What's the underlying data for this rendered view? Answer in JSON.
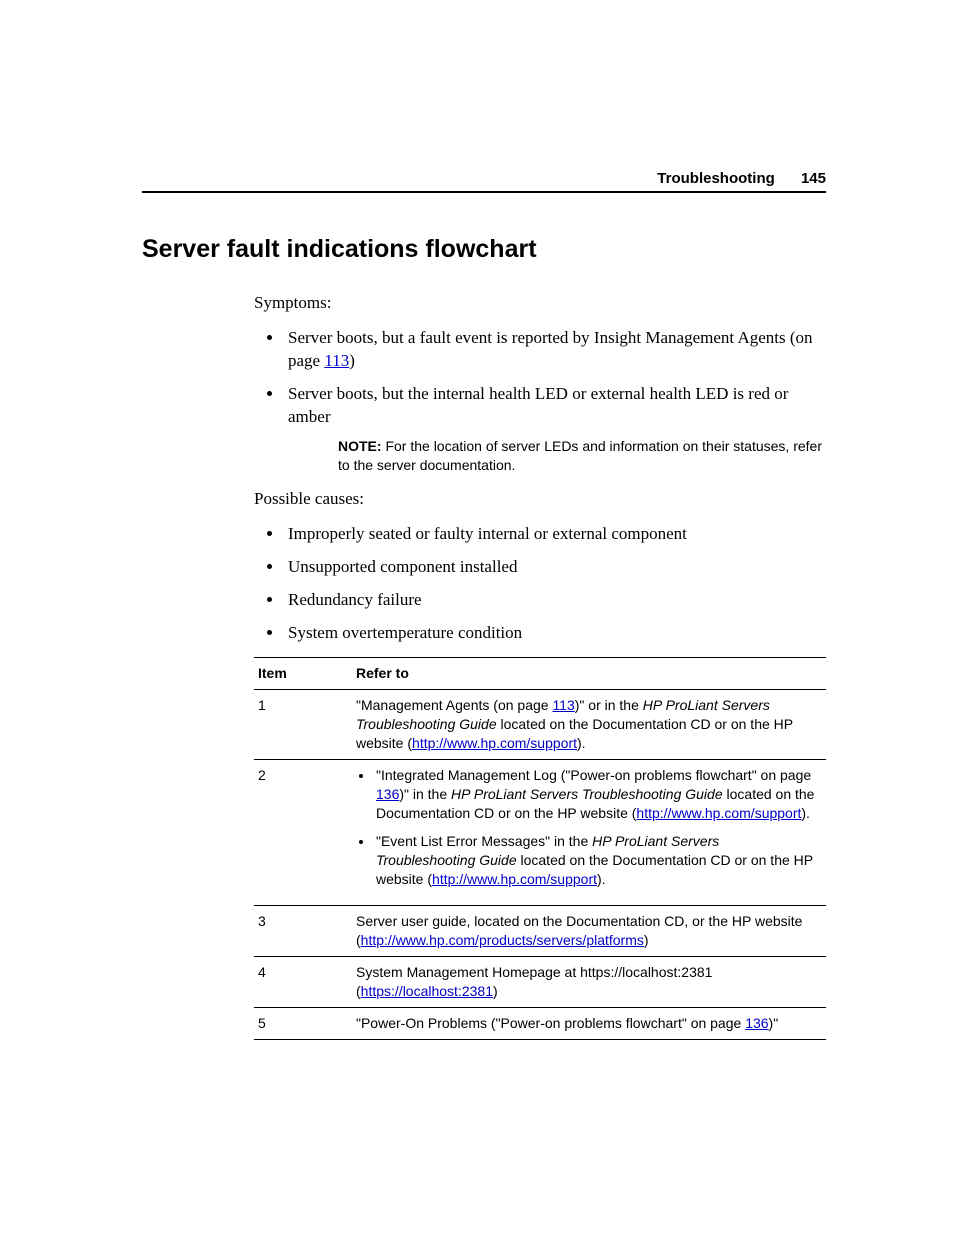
{
  "header": {
    "section": "Troubleshooting",
    "page": "145"
  },
  "title": "Server fault indications flowchart",
  "symptoms_label": "Symptoms:",
  "symptoms": {
    "s1_a": "Server boots, but a fault event is reported by Insight Management Agents (on page ",
    "s1_link": "113",
    "s1_b": ")",
    "s2": "Server boots, but the internal health LED or external health LED is red or amber"
  },
  "note": {
    "label": "NOTE:",
    "text": "  For the location of server LEDs and information on their statuses, refer to the server documentation."
  },
  "causes_label": "Possible causes:",
  "causes": {
    "c1": "Improperly seated or faulty internal or external component",
    "c2": "Unsupported component installed",
    "c3": "Redundancy failure",
    "c4": "System overtemperature condition"
  },
  "table": {
    "h_item": "Item",
    "h_refer": "Refer to",
    "r1": {
      "item": "1",
      "a": "\"Management Agents (on page ",
      "link1": "113",
      "b": ")\" or in the ",
      "italic1": "HP ProLiant Servers Troubleshooting Guide",
      "c": " located on the Documentation CD or on the HP website (",
      "url": "http://www.hp.com/support",
      "d": ")."
    },
    "r2": {
      "item": "2",
      "li1_a": "\"Integrated Management Log (\"Power-on problems flowchart\" on page ",
      "li1_link": "136",
      "li1_b": ")\" in the ",
      "li1_italic": "HP ProLiant Servers Troubleshooting Guide",
      "li1_c": " located on the Documentation CD or on the HP website (",
      "li1_url": "http://www.hp.com/support",
      "li1_d": ").",
      "li2_a": "\"Event List Error Messages\" in the ",
      "li2_italic": "HP ProLiant Servers Troubleshooting Guide",
      "li2_b": " located on the Documentation CD or on the HP website (",
      "li2_url": "http://www.hp.com/support",
      "li2_c": ")."
    },
    "r3": {
      "item": "3",
      "a": "Server user guide, located on the Documentation CD, or the HP website (",
      "url": "http://www.hp.com/products/servers/platforms",
      "b": ")"
    },
    "r4": {
      "item": "4",
      "a": "System Management Homepage at https://localhost:2381 (",
      "url": "https://localhost:2381",
      "b": ")"
    },
    "r5": {
      "item": "5",
      "a": "\"Power-On Problems (\"Power-on problems flowchart\" on page ",
      "link": "136",
      "b": ")\""
    }
  }
}
